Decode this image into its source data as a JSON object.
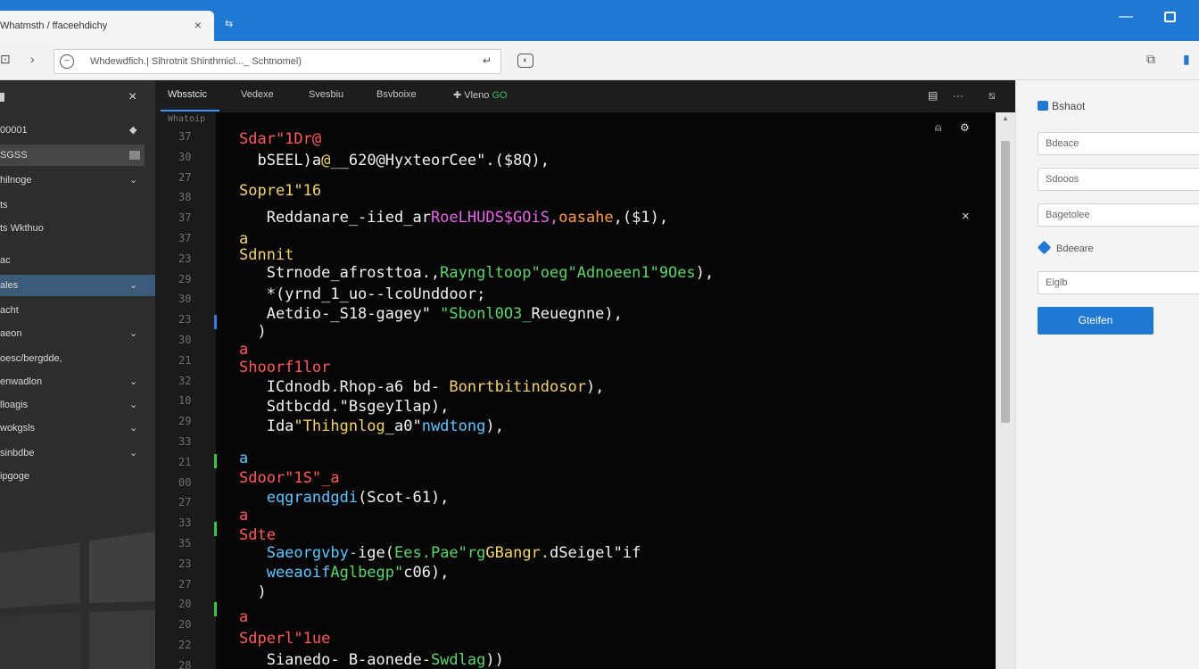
{
  "browser": {
    "tab_title": "Whatmsth / ffaceehdichy",
    "tab_close": "×",
    "new_tab": "⇆",
    "address": "Whdewdfich.| Sihrotnit Shinthmicl..._ Schtnomel)",
    "go": "↵"
  },
  "sidebar": {
    "close": "×",
    "items": [
      {
        "label": "00001",
        "chev": "◆"
      },
      {
        "label": "SGSS",
        "chev": "›"
      },
      {
        "label": "hilnoge",
        "chev": "⌄"
      },
      {
        "label": "ts",
        "chev": ""
      },
      {
        "label": "ts Wkthuo",
        "chev": ""
      },
      {
        "label": "ac",
        "chev": ""
      },
      {
        "label": "ales",
        "chev": "⌄"
      },
      {
        "label": "acht",
        "chev": ""
      },
      {
        "label": "aeon",
        "chev": "⌄"
      },
      {
        "label": "oesc/bergdde,",
        "chev": ""
      },
      {
        "label": "enwadlon",
        "chev": "⌄"
      },
      {
        "label": "lloagis",
        "chev": "⌄"
      },
      {
        "label": "wokgsls",
        "chev": "⌄"
      },
      {
        "label": "sinbdbe",
        "chev": "⌄"
      },
      {
        "label": "ipgoge",
        "chev": ""
      }
    ]
  },
  "editor": {
    "tabs": [
      "Wbsstcic",
      "Vedexe",
      "Svesbiu",
      "Bsvboixe",
      "Vleno"
    ],
    "tab_badge": "GO",
    "gutter_header": "Whatoip",
    "line_numbers": [
      "37",
      "30",
      "27",
      "38",
      "37",
      "37",
      "23",
      "29",
      "30",
      "23",
      "30",
      "21",
      "32",
      "10",
      "29",
      "33",
      "21",
      "00",
      "27",
      "33",
      "35",
      "23",
      "27",
      "20",
      "20",
      "22",
      "28"
    ],
    "code": [
      {
        "segments": [
          {
            "t": "Sdar\"1Dr@",
            "c": "red"
          }
        ]
      },
      {
        "segments": [
          {
            "t": "  bSEEL)a",
            "c": "wht"
          },
          {
            "t": "@_",
            "c": "yel"
          },
          {
            "t": "_620@HyxteorCee\".",
            "c": "wht"
          },
          {
            "t": "($8Q),",
            "c": "wht"
          }
        ]
      },
      {
        "segments": [
          {
            "t": "Sopre1\"16",
            "c": "yel"
          }
        ]
      },
      {
        "segments": [
          {
            "t": "   Reddanare_-iied_ar",
            "c": "wht"
          },
          {
            "t": "RoeLHUDS$GOiS,",
            "c": "mag"
          },
          {
            "t": "oasahe",
            "c": "org"
          },
          {
            "t": ",($1),",
            "c": "wht"
          }
        ]
      },
      {
        "segments": [
          {
            "t": "a",
            "c": "yel"
          }
        ]
      },
      {
        "segments": [
          {
            "t": "Sdnnit",
            "c": "yel"
          }
        ]
      },
      {
        "segments": [
          {
            "t": "   Strnode_afrosttoa.,",
            "c": "wht"
          },
          {
            "t": "Rayngltoop\"oeg\"",
            "c": "grn"
          },
          {
            "t": "Adnoeen1\"9Oes",
            "c": "grn"
          },
          {
            "t": "),",
            "c": "wht"
          }
        ]
      },
      {
        "segments": [
          {
            "t": "   *(yrnd_1_uo--",
            "c": "wht"
          },
          {
            "t": "lcoUnddoor;",
            "c": "wht"
          }
        ]
      },
      {
        "segments": [
          {
            "t": "   Aetdio-_S18-gagey\" ",
            "c": "wht"
          },
          {
            "t": "\"Sbonl0O3_",
            "c": "grn"
          },
          {
            "t": "Reuegnne),",
            "c": "wht"
          }
        ]
      },
      {
        "segments": [
          {
            "t": "  )",
            "c": "wht"
          }
        ]
      },
      {
        "segments": [
          {
            "t": "a",
            "c": "red"
          }
        ]
      },
      {
        "segments": [
          {
            "t": "Shoorf1lor",
            "c": "red"
          }
        ]
      },
      {
        "segments": [
          {
            "t": "   ICdnodb.Rhop-a6 bd- ",
            "c": "wht"
          },
          {
            "t": "Bonrtbitindosor",
            "c": "yel"
          },
          {
            "t": "),",
            "c": "wht"
          }
        ]
      },
      {
        "segments": [
          {
            "t": "   Sdtbcdd.",
            "c": "wht"
          },
          {
            "t": "\"Bsgey",
            "c": "wht"
          },
          {
            "t": "Ilap",
            "c": "wht"
          },
          {
            "t": "),",
            "c": "wht"
          }
        ]
      },
      {
        "segments": [
          {
            "t": "   Ida",
            "c": "wht"
          },
          {
            "t": "\"Thihgnlog",
            "c": "yel"
          },
          {
            "t": "_a0\"",
            "c": "wht"
          },
          {
            "t": "nwdtong",
            "c": "cyn"
          },
          {
            "t": "),",
            "c": "wht"
          }
        ]
      },
      {
        "segments": [
          {
            "t": "a",
            "c": "cyn"
          }
        ]
      },
      {
        "segments": [
          {
            "t": "Sdoor\"1S\"_a",
            "c": "red"
          }
        ]
      },
      {
        "segments": [
          {
            "t": "   eqgrandgdi",
            "c": "cyn"
          },
          {
            "t": "(Scot-61),",
            "c": "wht"
          }
        ]
      },
      {
        "segments": [
          {
            "t": "a",
            "c": "red"
          }
        ]
      },
      {
        "segments": [
          {
            "t": "Sdte",
            "c": "red"
          }
        ]
      },
      {
        "segments": [
          {
            "t": "   Saeorgvby-",
            "c": "cyn"
          },
          {
            "t": "ige(",
            "c": "wht"
          },
          {
            "t": "Ees.Pae\"rg",
            "c": "grn"
          },
          {
            "t": "GBangr.",
            "c": "yel"
          },
          {
            "t": "dSeigel\"if",
            "c": "wht"
          }
        ]
      },
      {
        "segments": [
          {
            "t": "   weeaoif",
            "c": "cyn"
          },
          {
            "t": "Aglbegp\"",
            "c": "grn"
          },
          {
            "t": "c06),",
            "c": "wht"
          }
        ]
      },
      {
        "segments": [
          {
            "t": "  )",
            "c": "wht"
          }
        ]
      },
      {
        "segments": [
          {
            "t": "a",
            "c": "red"
          }
        ]
      },
      {
        "segments": [
          {
            "t": "Sdperl\"1ue",
            "c": "red"
          }
        ]
      },
      {
        "segments": [
          {
            "t": "   Sianedo- B-aonede-",
            "c": "wht"
          },
          {
            "t": "Swdlag",
            "c": "grn"
          },
          {
            "t": "))",
            "c": "wht"
          }
        ]
      }
    ],
    "close_x": "×"
  },
  "right_panel": {
    "heading": "Bshaot",
    "fields": [
      "Bdeace",
      "Sdooos",
      "Bagetolee"
    ],
    "radio_label": "Bdeeare",
    "field4": "Eiglb",
    "button": "Gteifen"
  },
  "colors": {
    "titlebar": "#1f78d1",
    "editor_bg": "#060606",
    "accent": "#1f78d1"
  }
}
